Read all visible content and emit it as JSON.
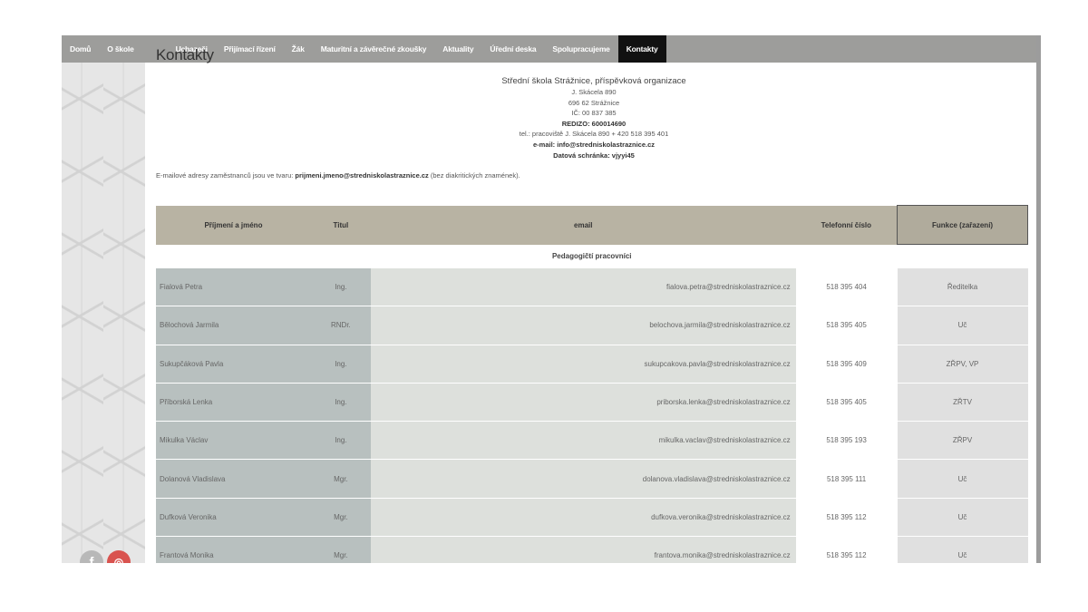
{
  "nav": {
    "pre": [
      "Domů",
      "O škole"
    ],
    "items": [
      "Uchazeči",
      "Přijímací řízení",
      "Žák",
      "Maturitní a závěrečné zkoušky",
      "Aktuality",
      "Úřední deska",
      "Spolupracujeme",
      "Kontakty"
    ]
  },
  "page_title": "Kontakty",
  "address": {
    "school": "Střední škola Strážnice, příspěvková organizace",
    "street": "J. Skácela 890",
    "city": "696 62 Strážnice",
    "ic": "IČ: 00 837 385",
    "redizo": "REDIZO: 600014690",
    "tel": "tel.: pracoviště J. Skácela 890 + 420 518 395 401",
    "email": "e-mail: info@stredniskolastraznice.cz",
    "databox": "Datová schránka: vjyyi45"
  },
  "note": {
    "prefix": "E-mailové adresy zaměstnanců jsou ve tvaru: ",
    "format": "prijmeni.jmeno@stredniskolastraznice.cz",
    "suffix": " (bez diakritických znamének)."
  },
  "table": {
    "headers": [
      "Příjmení a jméno",
      "Titul",
      "email",
      "Telefonní číslo",
      "Funkce (zařazení)"
    ],
    "section": "Pedagogičtí pracovníci",
    "rows": [
      {
        "name": "Fialová Petra",
        "title": "Ing.",
        "email": "fialova.petra@stredniskolastraznice.cz",
        "phone": "518 395 404",
        "func": "Ředitelka"
      },
      {
        "name": "Bělochová Jarmila",
        "title": "RNDr.",
        "email": "belochova.jarmila@stredniskolastraznice.cz",
        "phone": "518 395 405",
        "func": "Uč"
      },
      {
        "name": "Sukupčáková Pavla",
        "title": "Ing.",
        "email": "sukupcakova.pavla@stredniskolastraznice.cz",
        "phone": "518 395 409",
        "func": "ZŘPV, VP"
      },
      {
        "name": "Příborská Lenka",
        "title": "Ing.",
        "email": "priborska.lenka@stredniskolastraznice.cz",
        "phone": "518 395 405",
        "func": "ZŘTV"
      },
      {
        "name": "Mikulka Václav",
        "title": "Ing.",
        "email": "mikulka.vaclav@stredniskolastraznice.cz",
        "phone": "518 395 193",
        "func": "ZŘPV"
      },
      {
        "name": "Dolanová Vladislava",
        "title": "Mgr.",
        "email": "dolanova.vladislava@stredniskolastraznice.cz",
        "phone": "518 395 111",
        "func": "Uč"
      },
      {
        "name": "Dufková Veronika",
        "title": "Mgr.",
        "email": "dufkova.veronika@stredniskolastraznice.cz",
        "phone": "518 395 112",
        "func": "Uč"
      },
      {
        "name": "Frantová Monika",
        "title": "Mgr.",
        "email": "frantova.monika@stredniskolastraznice.cz",
        "phone": "518 395 112",
        "func": "Uč"
      }
    ]
  },
  "social": {
    "facebook": "f",
    "instagram": "◎"
  }
}
